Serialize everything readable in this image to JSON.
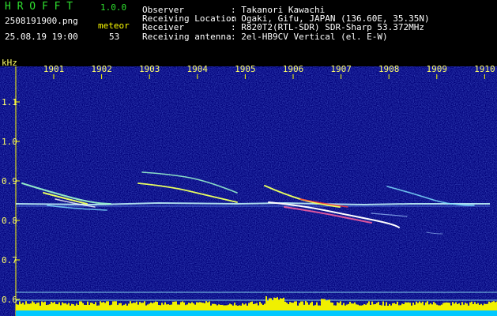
{
  "header": {
    "brand": "H R O F F T",
    "version": "1.0.0",
    "filename": "2508191900.png",
    "datetime": "25.08.19 19:00",
    "meteor_label": "meteor",
    "meteor_count": "53",
    "info": [
      {
        "label": "Observer",
        "value": ": Takanori Kawachi"
      },
      {
        "label": "Receiving Location",
        "value": ": Ogaki, Gifu, JAPAN (136.60E, 35.35N)"
      },
      {
        "label": "Receiver",
        "value": ": R820T2(RTL-SDR) SDR-Sharp 53.372MHz"
      },
      {
        "label": "Receiving antenna",
        "value": ": 2el-HB9CV Vertical (el. E-W)"
      }
    ]
  },
  "spectrogram": {
    "y_unit": "kHz",
    "time_ticks": [
      "1901",
      "1902",
      "1903",
      "1904",
      "1905",
      "1906",
      "1907",
      "1908",
      "1909",
      "1910"
    ],
    "freq_ticks": [
      "1.1",
      "1.0",
      "0.9",
      "0.8",
      "0.7",
      "0.6"
    ],
    "colors": {
      "background": "#00008a",
      "axis": "#ffff00",
      "carrier": "#c8ffff",
      "meteor": "#ffff40",
      "bars": "#f0f000",
      "floor": "#00c8ff"
    }
  }
}
